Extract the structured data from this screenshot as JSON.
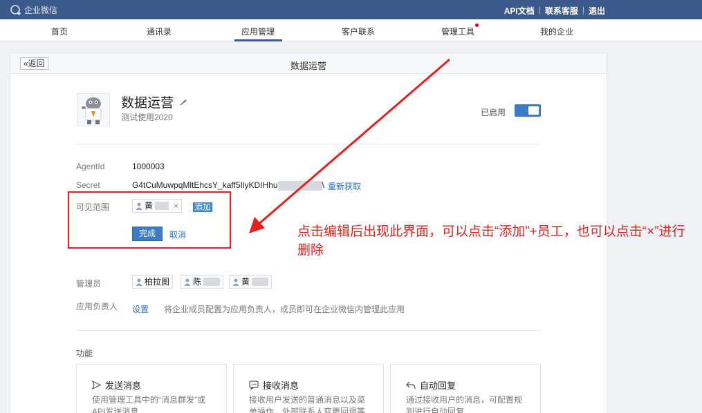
{
  "topbar": {
    "logo_text": "企业微信",
    "links": [
      "API文档",
      "联系客服",
      "退出"
    ]
  },
  "nav": {
    "items": [
      "首页",
      "通讯录",
      "应用管理",
      "客户联系",
      "管理工具",
      "我的企业"
    ],
    "active": "应用管理"
  },
  "panel": {
    "back_label": "«返回",
    "title": "数据运营"
  },
  "app": {
    "name": "数据运营",
    "description": "测试使用2020",
    "status_label": "已启用",
    "enabled": true
  },
  "fields": {
    "agentid_label": "AgentId",
    "agentid_value": "1000003",
    "secret_label": "Secret",
    "secret_value": "G4tCuMuwpqMltEhcsY_kaff5IlyKDIHhu",
    "secret_suffix": "\\",
    "refresh_label": "重新获取",
    "visible_label": "可见范围",
    "visible_tag": "黄",
    "add_label": "添加",
    "done_label": "完成",
    "cancel_label": "取消",
    "admin_label": "管理员",
    "admins": [
      "柏拉图",
      "陈",
      "黄"
    ],
    "owner_label": "应用负责人",
    "owner_set_label": "设置",
    "owner_hint": "将企业成员配置为应用负责人，成员即可在企业微信内管理此应用"
  },
  "features": {
    "title": "功能",
    "cards": [
      {
        "icon": "send-icon",
        "title": "发送消息",
        "desc": "使用管理工具中的“消息群发”或API发送消息"
      },
      {
        "icon": "receive-icon",
        "title": "接收消息",
        "desc": "接收用户发送的普通消息以及菜单操作、外部联系人变更回调等"
      },
      {
        "icon": "reply-icon",
        "title": "自动回复",
        "desc": "通过接收用户的消息，可配置规则进行自动回复"
      }
    ]
  },
  "annotation": {
    "text": "点击编辑后出现此界面，可以点击“添加”+员工，也可以点击“×”进行删除"
  },
  "colors": {
    "topbar": "#3b5a8a",
    "accent": "#3b7bc9",
    "annotation": "#e6201c"
  }
}
